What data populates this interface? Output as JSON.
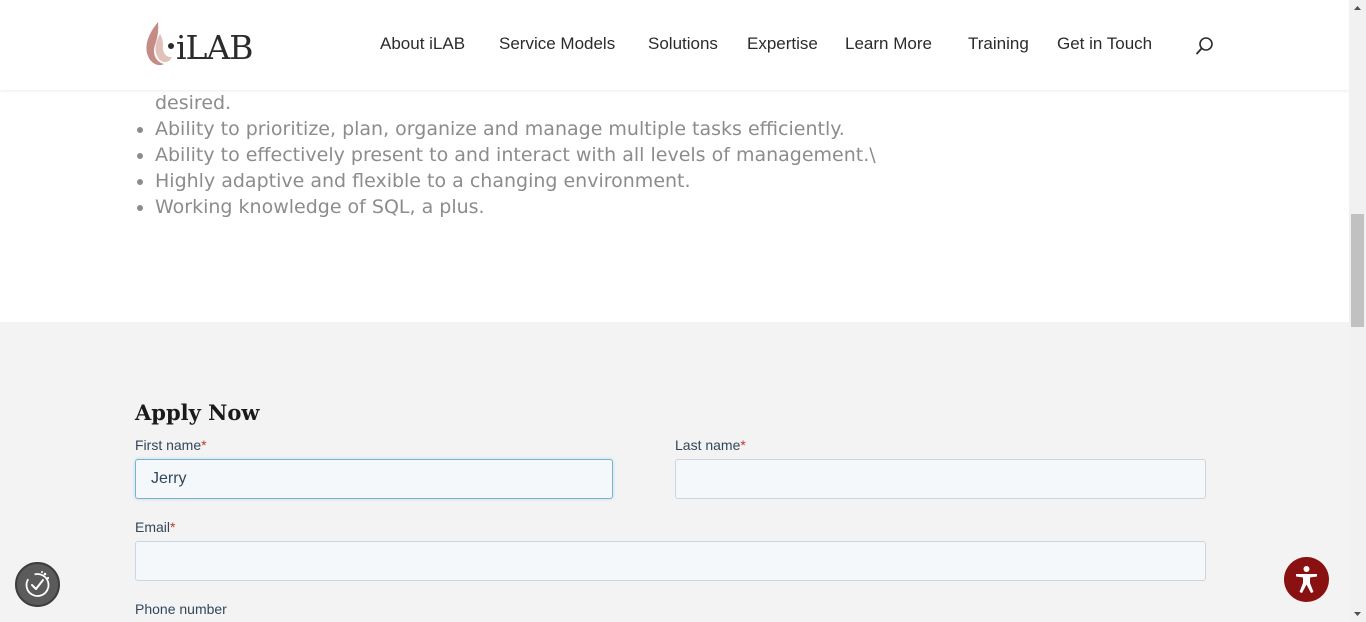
{
  "header": {
    "logo_text": "iLAB",
    "nav": [
      {
        "label": "About iLAB"
      },
      {
        "label": "Service Models"
      },
      {
        "label": "Solutions"
      },
      {
        "label": "Expertise"
      },
      {
        "label": "Learn More"
      },
      {
        "label": "Training"
      },
      {
        "label": "Get in Touch"
      }
    ],
    "search_icon": "search-icon"
  },
  "requirements": {
    "continued_text": "desired.",
    "items": [
      "Ability to prioritize, plan, organize and manage multiple tasks efficiently.",
      "Ability to effectively present to and interact with all levels of management.\\",
      "Highly adaptive and flexible to a changing environment.",
      "Working knowledge of SQL, a plus."
    ]
  },
  "form": {
    "title": "Apply Now",
    "required_marker": "*",
    "first_name": {
      "label": "First name",
      "value": "Jerry"
    },
    "last_name": {
      "label": "Last name",
      "value": ""
    },
    "email": {
      "label": "Email",
      "value": ""
    },
    "phone": {
      "label": "Phone number"
    }
  },
  "widgets": {
    "consent_icon": "cookie-consent-icon",
    "accessibility_icon": "accessibility-icon"
  },
  "colors": {
    "text_muted": "#8c8c8c",
    "form_bg": "#f3f3f3",
    "required": "#c0392b",
    "accessibility_bg": "#8a1111",
    "logo_flame": "#c48c85"
  }
}
